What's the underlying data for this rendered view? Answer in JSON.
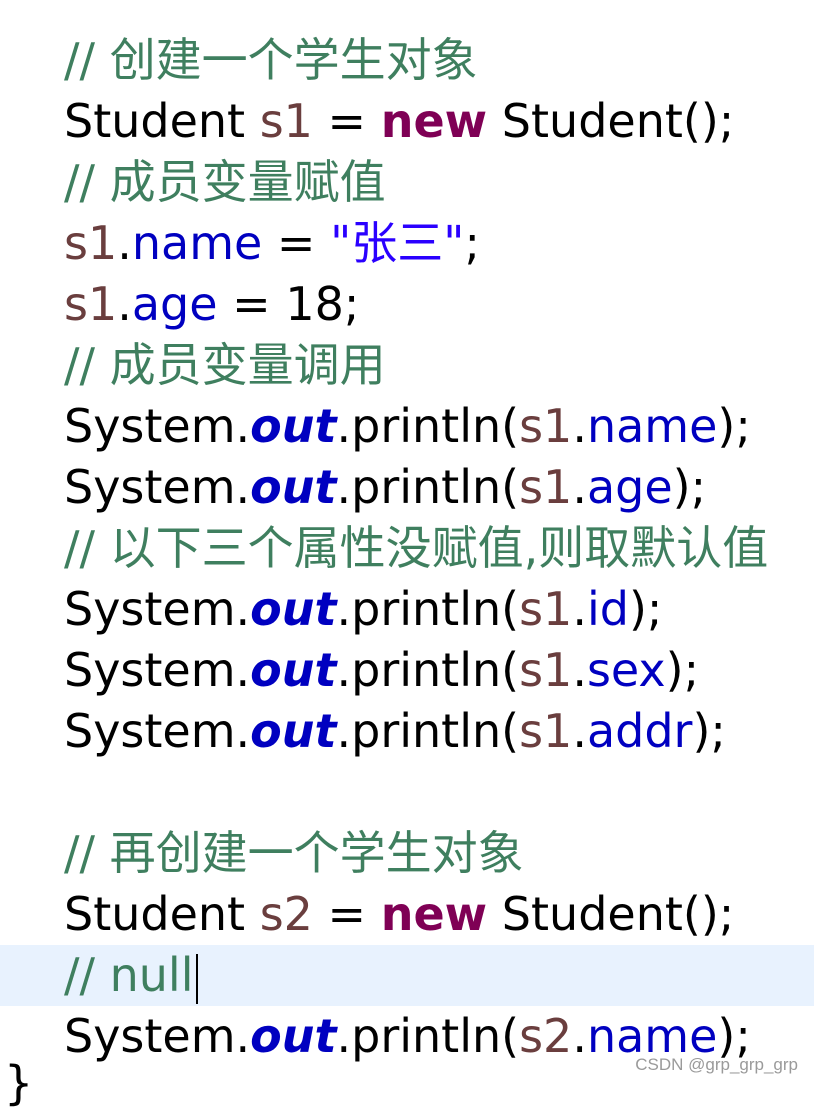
{
  "editor": {
    "lines": [
      {
        "tokens": [
          {
            "t": "comment",
            "v": "// 创建一个学生对象"
          }
        ]
      },
      {
        "tokens": [
          {
            "t": "plain",
            "v": "Student "
          },
          {
            "t": "local",
            "v": "s1"
          },
          {
            "t": "plain",
            "v": " = "
          },
          {
            "t": "keyword",
            "v": "new"
          },
          {
            "t": "plain",
            "v": " Student();"
          }
        ]
      },
      {
        "tokens": [
          {
            "t": "comment",
            "v": "// 成员变量赋值"
          }
        ]
      },
      {
        "tokens": [
          {
            "t": "local",
            "v": "s1"
          },
          {
            "t": "plain",
            "v": "."
          },
          {
            "t": "field",
            "v": "name"
          },
          {
            "t": "plain",
            "v": " = "
          },
          {
            "t": "string",
            "v": "\"张三\""
          },
          {
            "t": "plain",
            "v": ";"
          }
        ]
      },
      {
        "tokens": [
          {
            "t": "local",
            "v": "s1"
          },
          {
            "t": "plain",
            "v": "."
          },
          {
            "t": "field",
            "v": "age"
          },
          {
            "t": "plain",
            "v": " = 18;"
          }
        ]
      },
      {
        "tokens": [
          {
            "t": "comment",
            "v": "// 成员变量调用"
          }
        ]
      },
      {
        "tokens": [
          {
            "t": "plain",
            "v": "System."
          },
          {
            "t": "static",
            "v": "out"
          },
          {
            "t": "plain",
            "v": ".println("
          },
          {
            "t": "local",
            "v": "s1"
          },
          {
            "t": "plain",
            "v": "."
          },
          {
            "t": "field",
            "v": "name"
          },
          {
            "t": "plain",
            "v": ");"
          }
        ]
      },
      {
        "tokens": [
          {
            "t": "plain",
            "v": "System."
          },
          {
            "t": "static",
            "v": "out"
          },
          {
            "t": "plain",
            "v": ".println("
          },
          {
            "t": "local",
            "v": "s1"
          },
          {
            "t": "plain",
            "v": "."
          },
          {
            "t": "field",
            "v": "age"
          },
          {
            "t": "plain",
            "v": ");"
          }
        ]
      },
      {
        "tokens": [
          {
            "t": "comment",
            "v": "// 以下三个属性没赋值,则取默认值"
          }
        ]
      },
      {
        "tokens": [
          {
            "t": "plain",
            "v": "System."
          },
          {
            "t": "static",
            "v": "out"
          },
          {
            "t": "plain",
            "v": ".println("
          },
          {
            "t": "local",
            "v": "s1"
          },
          {
            "t": "plain",
            "v": "."
          },
          {
            "t": "field",
            "v": "id"
          },
          {
            "t": "plain",
            "v": ");"
          }
        ]
      },
      {
        "tokens": [
          {
            "t": "plain",
            "v": "System."
          },
          {
            "t": "static",
            "v": "out"
          },
          {
            "t": "plain",
            "v": ".println("
          },
          {
            "t": "local",
            "v": "s1"
          },
          {
            "t": "plain",
            "v": "."
          },
          {
            "t": "field",
            "v": "sex"
          },
          {
            "t": "plain",
            "v": ");"
          }
        ]
      },
      {
        "tokens": [
          {
            "t": "plain",
            "v": "System."
          },
          {
            "t": "static",
            "v": "out"
          },
          {
            "t": "plain",
            "v": ".println("
          },
          {
            "t": "local",
            "v": "s1"
          },
          {
            "t": "plain",
            "v": "."
          },
          {
            "t": "field",
            "v": "addr"
          },
          {
            "t": "plain",
            "v": ");"
          }
        ]
      },
      {
        "tokens": []
      },
      {
        "tokens": [
          {
            "t": "comment",
            "v": "// 再创建一个学生对象"
          }
        ]
      },
      {
        "tokens": [
          {
            "t": "plain",
            "v": "Student "
          },
          {
            "t": "local",
            "v": "s2"
          },
          {
            "t": "plain",
            "v": " = "
          },
          {
            "t": "keyword",
            "v": "new"
          },
          {
            "t": "plain",
            "v": " Student();"
          }
        ]
      },
      {
        "tokens": [
          {
            "t": "comment",
            "v": "// null"
          }
        ],
        "current": true
      },
      {
        "tokens": [
          {
            "t": "plain",
            "v": "System."
          },
          {
            "t": "static",
            "v": "out"
          },
          {
            "t": "plain",
            "v": ".println("
          },
          {
            "t": "local",
            "v": "s2"
          },
          {
            "t": "plain",
            "v": "."
          },
          {
            "t": "field",
            "v": "name"
          },
          {
            "t": "plain",
            "v": ");"
          }
        ]
      }
    ],
    "closing_brace": "}"
  },
  "watermark": "CSDN @grp_grp_grp",
  "colors": {
    "comment": "#3f7f5f",
    "keyword": "#7f0055",
    "field": "#0000c0",
    "string": "#2a00ff",
    "local": "#6a3e3e",
    "current_line": "#e8f2fe"
  }
}
